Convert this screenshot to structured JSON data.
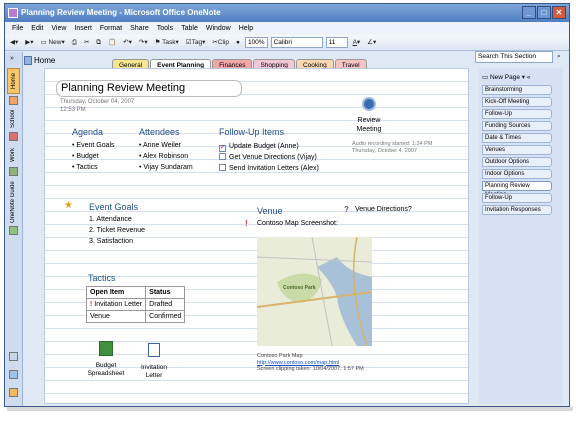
{
  "window": {
    "title": "Planning Review Meeting - Microsoft Office OneNote"
  },
  "menubar": [
    "File",
    "Edit",
    "View",
    "Insert",
    "Format",
    "Share",
    "Tools",
    "Table",
    "Window",
    "Help"
  ],
  "toolbar": {
    "new_label": "New",
    "task_label": "Task",
    "tag_label": "Tag",
    "clip_label": "Clip",
    "zoom": "100%",
    "font": "Calibri",
    "font_size": "11"
  },
  "left_tabs": [
    "Home",
    "School",
    "Work",
    "OneNote Guide"
  ],
  "header": {
    "notebook": "Home",
    "tabs": [
      {
        "label": "General",
        "color": "#f6e58f"
      },
      {
        "label": "Event Planning",
        "color": "#fff"
      },
      {
        "label": "Finances",
        "color": "#f3a6a6"
      },
      {
        "label": "Shopping",
        "color": "#f3c7d8"
      },
      {
        "label": "Cooking",
        "color": "#f9d7ae"
      },
      {
        "label": "Travel",
        "color": "#f6c3c3"
      }
    ]
  },
  "search": {
    "placeholder": "Search This Section"
  },
  "sidebar": {
    "new_page": "New Page",
    "pages": [
      "Brainstorming",
      "Kick-Off Meeting",
      "Follow-Up",
      "Funding Sources",
      "Date & Times",
      "Venues",
      "Outdoor Options",
      "Indoor Options",
      "Planning Review Meeting",
      "Follow-Up",
      "Invitation Responses"
    ],
    "active_index": 8
  },
  "page": {
    "title": "Planning Review Meeting",
    "date": "Thursday, October 04, 2007",
    "time": "12:53 PM",
    "recording": {
      "label": "Review Meeting",
      "started": "Audio recording started: 1:34 PM",
      "date": "Thursday, October 4, 2007"
    },
    "agenda": {
      "heading": "Agenda",
      "items": [
        "Event Goals",
        "Budget",
        "Tactics"
      ]
    },
    "attendees": {
      "heading": "Attendees",
      "items": [
        "Anne Weiler",
        "Alex Robinson",
        "Vijay Sundaram"
      ]
    },
    "followup": {
      "heading": "Follow-Up Items",
      "items": [
        {
          "text": "Update Budget (Anne)",
          "checked": true
        },
        {
          "text": "Get Venue Directions (Vijay)",
          "checked": false
        },
        {
          "text": "Send Invitation Letters (Alex)",
          "checked": false
        }
      ]
    },
    "event_goals": {
      "heading": "Event Goals",
      "items": [
        "1.   Attendance",
        "2.   Ticket Revenue",
        "3.   Satisfaction"
      ]
    },
    "venue": {
      "heading": "Venue",
      "directions": "Venue Directions?",
      "map_caption": "Contoso Map Screenshot:",
      "park_label": "Contoso Park",
      "source_title": "Contoso Park Map",
      "source_url": "http://www.contoso.com/map.html",
      "clip_taken": "Screen clipping taken: 10/04/2007, 1:57 PM"
    },
    "tactics": {
      "heading": "Tactics",
      "columns": [
        "Open Item",
        "Status"
      ],
      "rows": [
        [
          "Invitation Letter",
          "Drafted"
        ],
        [
          "Venue",
          "Confirmed"
        ]
      ]
    },
    "attachments": [
      "Budget Spreadsheet",
      "Invitation Letter"
    ]
  }
}
